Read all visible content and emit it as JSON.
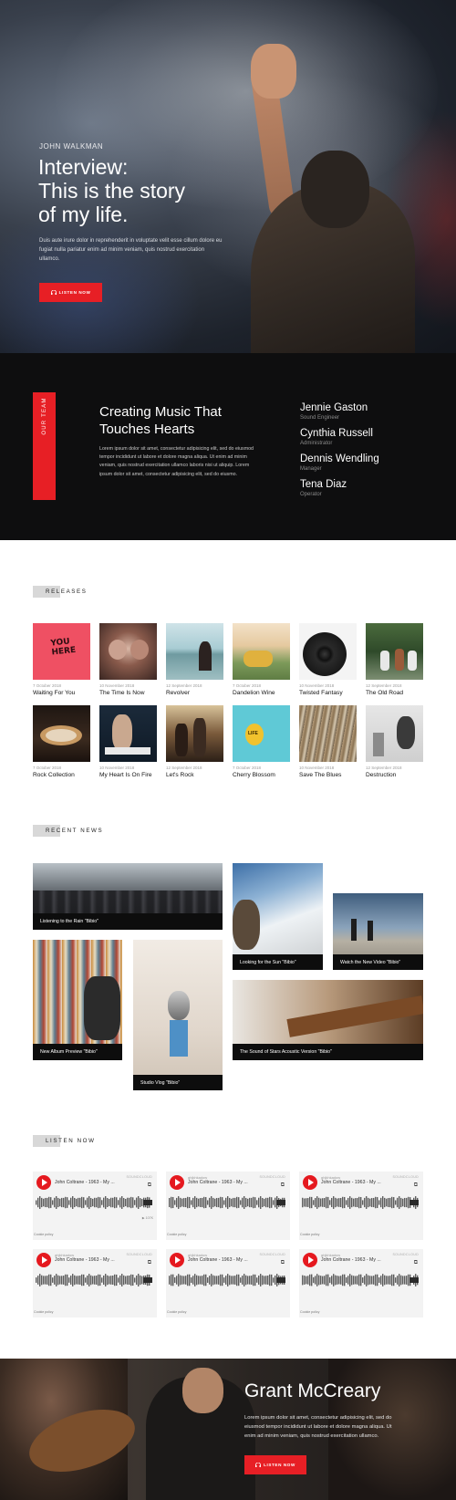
{
  "hero": {
    "kicker": "JOHN WALKMAN",
    "title_line1": "Interview:",
    "title_line2": "This is the story",
    "title_line3": "of my life.",
    "description": "Duis aute irure dolor in reprehenderit in voluptate velit esse cillum dolore eu fugiat nulla pariatur enim ad minim veniam, quis nostrud exercitation ullamco.",
    "button_label": "LISTEN NOW",
    "button_color": "#e71f25"
  },
  "team": {
    "side_label": "OUR TEAM",
    "title_line1": "Creating Music That",
    "title_line2": "Touches Hearts",
    "description": "Lorem ipsum dolor sit amet, consectetur adipisicing elit, sed do eiusmod tempor incididunt ut labore et dolore magna aliqua. Ut enim ad minim veniam, quis nostrud exercitation ullamco laboris nisi ut aliquip. Lorem ipsum dolor sit amet, consectetur adipisicing elit, sed do eiusmo.",
    "members": [
      {
        "name": "Jennie Gaston",
        "role": "Sound Engineer"
      },
      {
        "name": "Cynthia Russell",
        "role": "Administrator"
      },
      {
        "name": "Dennis Wendling",
        "role": "Manager"
      },
      {
        "name": "Tena Diaz",
        "role": "Operator"
      }
    ]
  },
  "releases": {
    "heading": "RELEASES",
    "items": [
      {
        "date": "7 October 2018",
        "title": "Waiting For You",
        "cover_text": "YOU HERE"
      },
      {
        "date": "10 November 2018",
        "title": "The Time Is Now"
      },
      {
        "date": "12 September 2018",
        "title": "Revolver"
      },
      {
        "date": "7 October 2018",
        "title": "Dandelion Wine"
      },
      {
        "date": "10 November 2018",
        "title": "Twisted Fantasy"
      },
      {
        "date": "12 September 2018",
        "title": "The Old Road"
      },
      {
        "date": "7 October 2018",
        "title": "Rock Collection"
      },
      {
        "date": "10 November 2018",
        "title": "My Heart Is On Fire"
      },
      {
        "date": "12 September 2018",
        "title": "Let's Rock"
      },
      {
        "date": "7 October 2018",
        "title": "Cherry Blossom",
        "cover_text": "LIFE"
      },
      {
        "date": "10 November 2018",
        "title": "Save The Blues"
      },
      {
        "date": "12 September 2018",
        "title": "Destruction"
      }
    ]
  },
  "news": {
    "heading": "RECENT NEWS",
    "items": [
      {
        "caption": "Listening to the Rain \"Bibio\""
      },
      {
        "caption": "Looking for the Sun \"Bibio\""
      },
      {
        "caption": "Watch the New Video \"Bibio\""
      },
      {
        "caption": "New Album Preview \"Bibio\""
      },
      {
        "caption": "Studio Vlog \"Bibio\""
      },
      {
        "caption": "The Sound of Stars Acoustic Version \"Bibio\""
      }
    ]
  },
  "listen": {
    "heading": "LISTEN NOW",
    "players": [
      {
        "user": "",
        "track": "John Coltrane - 1963 - My ...",
        "provider": "SOUNDCLOUD",
        "meta": "▶ 107K",
        "policy": "Cookie policy"
      },
      {
        "user": "ghjkhkadow",
        "track": "John Coltrane - 1963 - My ...",
        "provider": "SOUNDCLOUD",
        "meta": "",
        "policy": "Cookie policy"
      },
      {
        "user": "ghjkhkadow",
        "track": "John Coltrane - 1963 - My ...",
        "provider": "SOUNDCLOUD",
        "meta": "",
        "policy": "Cookie policy"
      },
      {
        "user": "ghjkhkadow",
        "track": "John Coltrane - 1963 - My ...",
        "provider": "SOUNDCLOUD",
        "meta": "",
        "policy": "Cookie policy"
      },
      {
        "user": "ghjkhkadow",
        "track": "John Coltrane - 1963 - My ...",
        "provider": "SOUNDCLOUD",
        "meta": "",
        "policy": "Cookie policy"
      },
      {
        "user": "ghjkhkadow",
        "track": "John Coltrane - 1963 - My ...",
        "provider": "SOUNDCLOUD",
        "meta": "",
        "policy": "Cookie policy"
      }
    ]
  },
  "artist": {
    "name": "Grant McCreary",
    "description": "Lorem ipsum dolor sit amet, consectetur adipisicing elit, sed do eiusmod tempor incididunt ut labore et dolore magna aliqua. Ut enim ad minim veniam, quis nostrud exercitation ullamco.",
    "button_label": "LISTEN NOW"
  },
  "icons": {
    "play": "play-icon",
    "share": "share-icon",
    "soundcloud": "soundcloud-icon",
    "headphones": "headphones-icon"
  },
  "colors": {
    "accent": "#e71f25",
    "dark_bg": "#0e0e0f",
    "player_play": "#e5191f"
  }
}
